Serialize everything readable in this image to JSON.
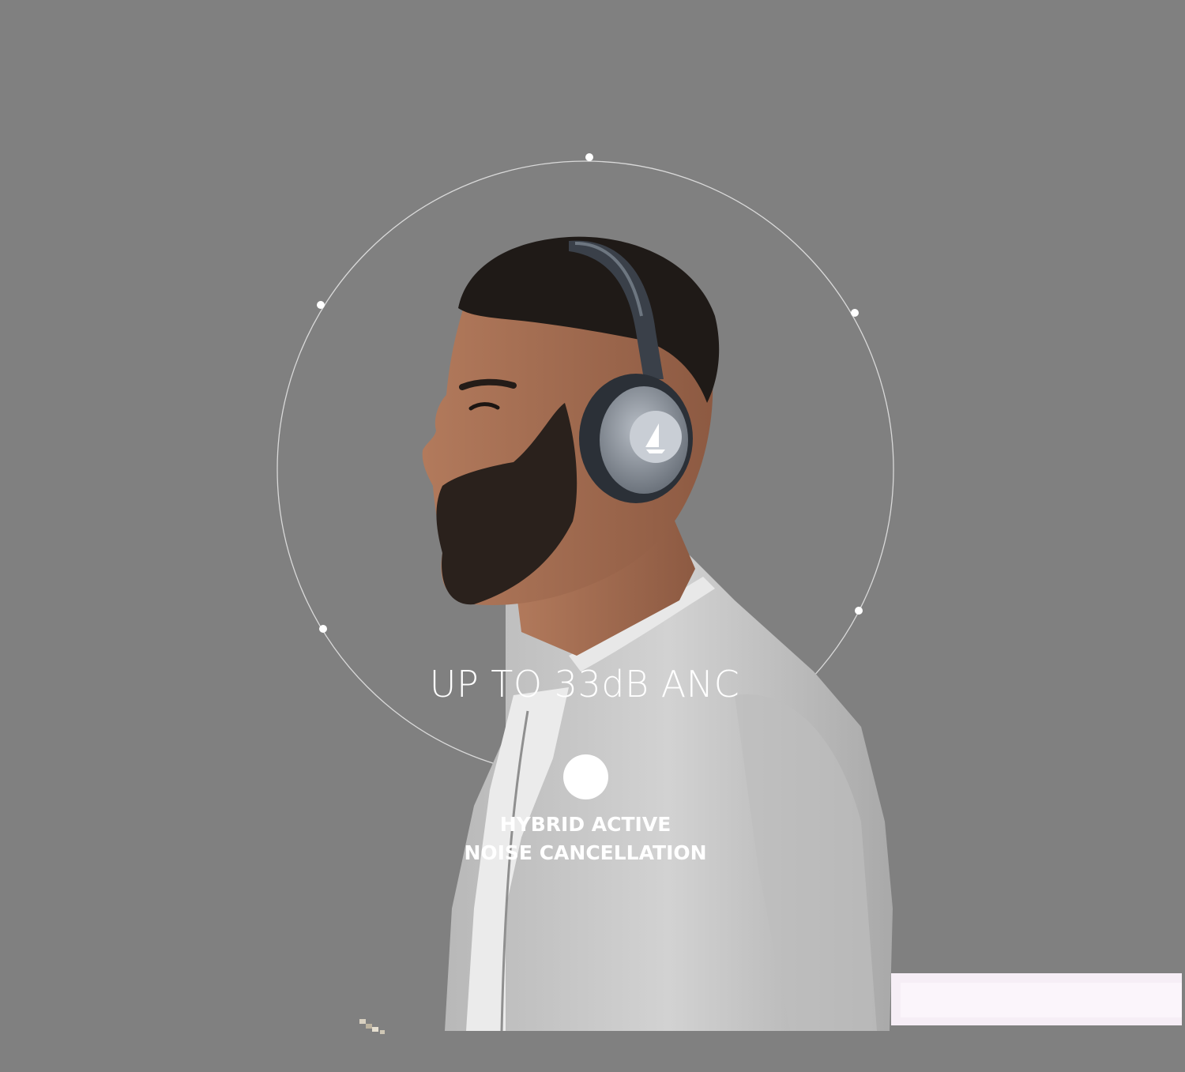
{
  "headline": "UP TO 33dB ANC",
  "feature": {
    "caption_line1": "HYBRID ACTIVE",
    "caption_line2": "NOISE CANCELLATION"
  },
  "colors": {
    "background": "#808080",
    "text": "#ffffff",
    "ring": "#dcdcdc",
    "headphone_body": "#3a3f47",
    "headphone_cup": "#8c939c",
    "sweater": "#c9c9c9",
    "skin": "#a06c52",
    "hair": "#1f1a17"
  },
  "icons": {
    "brand": "sail-logo-icon"
  }
}
